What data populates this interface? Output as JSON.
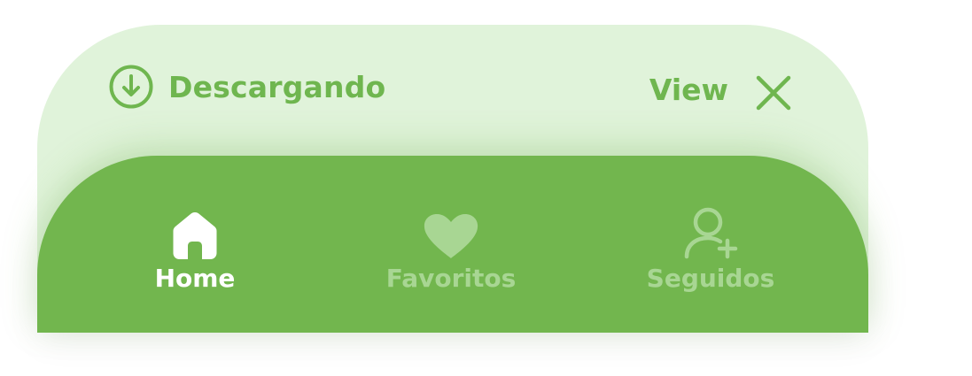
{
  "banner": {
    "icon": "download-circle-icon",
    "title": "Descargando",
    "view_label": "View",
    "close_icon": "close-icon"
  },
  "navbar": {
    "items": [
      {
        "label": "Home",
        "icon": "home-icon",
        "active": true
      },
      {
        "label": "Favoritos",
        "icon": "heart-icon",
        "active": false
      },
      {
        "label": "Seguidos",
        "icon": "user-add-icon",
        "active": false
      }
    ]
  },
  "colors": {
    "accent": "#72b64e",
    "banner_background": "#e0f3da",
    "banner_text": "#6fb64f",
    "active_label": "#ffffff",
    "inactive_label": "#a8d693"
  }
}
